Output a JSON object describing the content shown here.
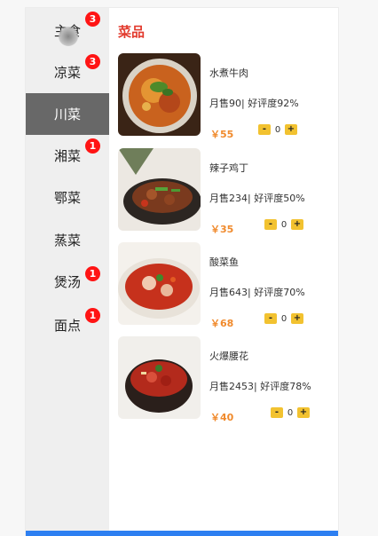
{
  "sidebar": {
    "categories": [
      {
        "label": "主食",
        "badge": "3"
      },
      {
        "label": "凉菜",
        "badge": "3"
      },
      {
        "label": "川菜",
        "badge": ""
      },
      {
        "label": "湘菜",
        "badge": "1"
      },
      {
        "label": "鄂菜",
        "badge": ""
      },
      {
        "label": "蒸菜",
        "badge": ""
      },
      {
        "label": "煲汤",
        "badge": "1"
      },
      {
        "label": "面点",
        "badge": "1"
      }
    ]
  },
  "main": {
    "section_title": "菜品",
    "dishes": [
      {
        "name": "水煮牛肉",
        "sales": "月售90| 好评度92%",
        "price": "￥55",
        "minus": "-",
        "qty": "0",
        "plus": "+"
      },
      {
        "name": "辣子鸡丁",
        "sales": "月售234| 好评度50%",
        "price": "￥35",
        "minus": "-",
        "qty": "0",
        "plus": "+"
      },
      {
        "name": "酸菜鱼",
        "sales": "月售643| 好评度70%",
        "price": "￥68",
        "minus": "-",
        "qty": "0",
        "plus": "+"
      },
      {
        "name": "火爆腰花",
        "sales": "月售2453| 好评度78%",
        "price": "￥40",
        "minus": "-",
        "qty": "0",
        "plus": "+"
      }
    ]
  },
  "colors": {
    "active_category_bg": "#686868",
    "badge": "#ff1414",
    "title": "#e23b2e",
    "price": "#f08a2c",
    "stepper": "#f2c230",
    "bottom_bar": "#2d7ff1"
  }
}
